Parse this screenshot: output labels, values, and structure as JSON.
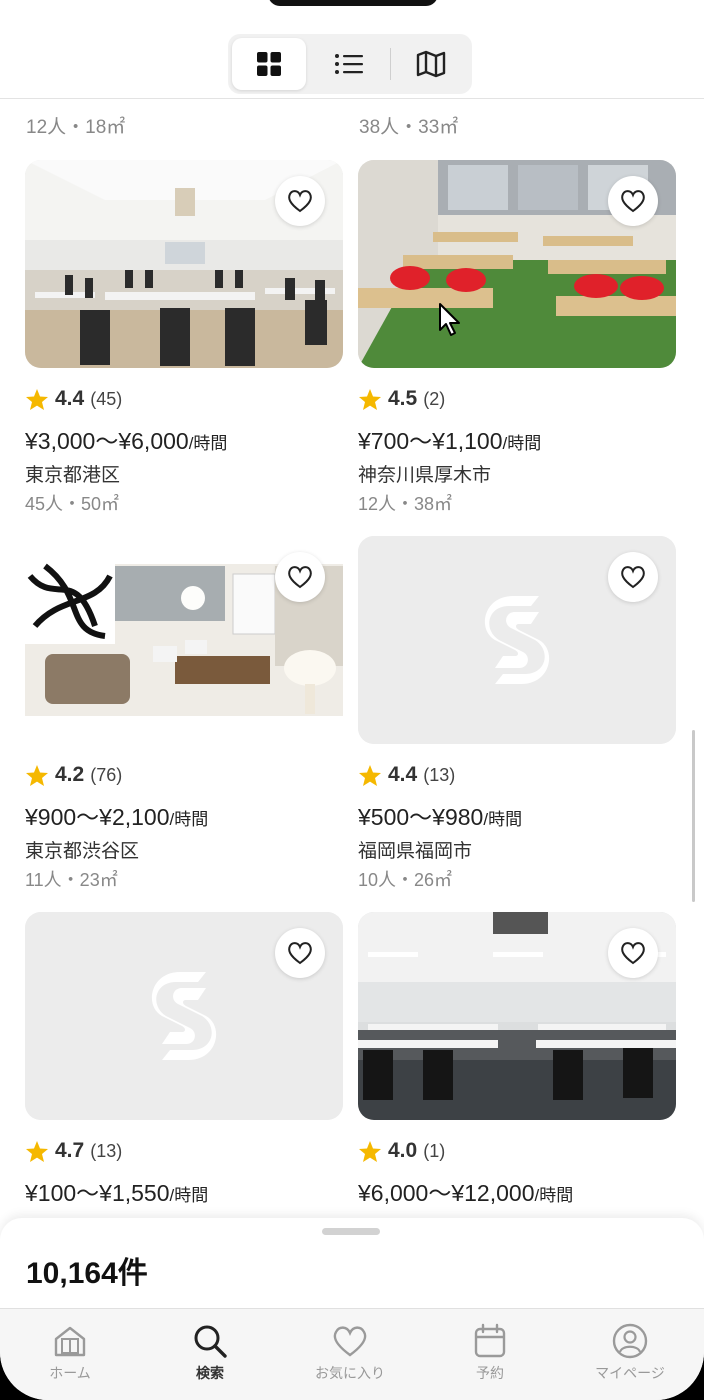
{
  "view_toggle": {
    "options": [
      "grid",
      "list",
      "map"
    ],
    "selected": "grid"
  },
  "partial_row": [
    {
      "meta": "12人・18㎡"
    },
    {
      "meta": "38人・33㎡"
    }
  ],
  "listings": [
    {
      "rating": "4.4",
      "reviews": "(45)",
      "price": "¥3,000〜¥6,000",
      "unit": "/時間",
      "location": "東京都港区",
      "meta": "45人・50㎡",
      "photo": "seminar-room-white"
    },
    {
      "rating": "4.5",
      "reviews": "(2)",
      "price": "¥700〜¥1,100",
      "unit": "/時間",
      "location": "神奈川県厚木市",
      "meta": "12人・38㎡",
      "photo": "classroom-red-chairs"
    },
    {
      "rating": "4.2",
      "reviews": "(76)",
      "price": "¥900〜¥2,100",
      "unit": "/時間",
      "location": "東京都渋谷区",
      "meta": "11人・23㎡",
      "photo": "lounge-room"
    },
    {
      "rating": "4.4",
      "reviews": "(13)",
      "price": "¥500〜¥980",
      "unit": "/時間",
      "location": "福岡県福岡市",
      "meta": "10人・26㎡",
      "photo": "placeholder"
    },
    {
      "rating": "4.7",
      "reviews": "(13)",
      "price": "¥100〜¥1,550",
      "unit": "/時間",
      "location": "",
      "meta": "",
      "photo": "placeholder"
    },
    {
      "rating": "4.0",
      "reviews": "(1)",
      "price": "¥6,000〜¥12,000",
      "unit": "/時間",
      "location": "",
      "meta": "",
      "photo": "large-seminar-hall"
    }
  ],
  "results": {
    "count": "10,164件"
  },
  "tabbar": {
    "items": [
      {
        "label": "ホーム",
        "icon": "home-icon"
      },
      {
        "label": "検索",
        "icon": "search-icon",
        "active": true
      },
      {
        "label": "お気に入り",
        "icon": "heart-icon"
      },
      {
        "label": "予約",
        "icon": "calendar-icon"
      },
      {
        "label": "マイページ",
        "icon": "user-icon"
      }
    ]
  },
  "colors": {
    "star": "#f5b800",
    "placeholder": "#ececec"
  }
}
